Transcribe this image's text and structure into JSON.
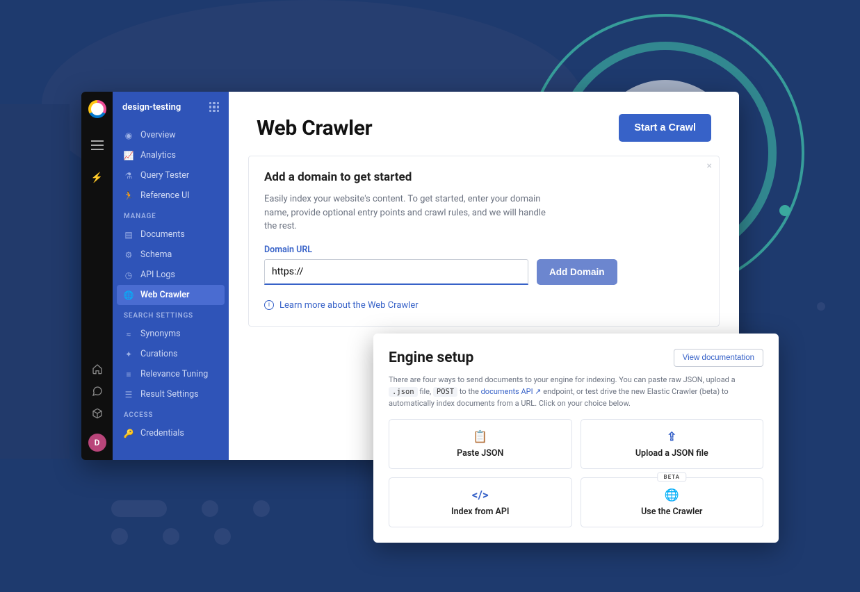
{
  "app_name": "design-testing",
  "rail": {
    "avatar_initial": "D"
  },
  "sidebar": {
    "groups": [
      {
        "label": "",
        "items": [
          {
            "icon": "binoculars-icon",
            "label": "Overview"
          },
          {
            "icon": "analytics-icon",
            "label": "Analytics"
          },
          {
            "icon": "flask-icon",
            "label": "Query Tester"
          },
          {
            "icon": "running-icon",
            "label": "Reference UI"
          }
        ]
      },
      {
        "label": "MANAGE",
        "items": [
          {
            "icon": "documents-icon",
            "label": "Documents"
          },
          {
            "icon": "gear-icon",
            "label": "Schema"
          },
          {
            "icon": "clock-icon",
            "label": "API Logs"
          },
          {
            "icon": "globe-icon",
            "label": "Web Crawler",
            "active": true
          }
        ]
      },
      {
        "label": "SEARCH SETTINGS",
        "items": [
          {
            "icon": "synonyms-icon",
            "label": "Synonyms"
          },
          {
            "icon": "curations-icon",
            "label": "Curations"
          },
          {
            "icon": "tuning-icon",
            "label": "Relevance Tuning"
          },
          {
            "icon": "results-icon",
            "label": "Result Settings"
          }
        ]
      },
      {
        "label": "ACCESS",
        "items": [
          {
            "icon": "key-icon",
            "label": "Credentials"
          }
        ]
      }
    ]
  },
  "page": {
    "title": "Web Crawler",
    "primary_action": "Start a Crawl",
    "card": {
      "title": "Add a domain to get started",
      "description": "Easily index your website's content. To get started, enter your domain name, provide optional entry points and crawl rules, and we will handle the rest.",
      "field_label": "Domain URL",
      "input_value": "https://",
      "submit_label": "Add Domain",
      "learn_more": "Learn more about the Web Crawler"
    }
  },
  "engine": {
    "title": "Engine setup",
    "doc_button": "View documentation",
    "description_parts": {
      "pre": "There are four ways to send documents to your engine for indexing. You can paste raw JSON, upload a ",
      "code1": ".json",
      "mid1": " file, ",
      "code2": "POST",
      "mid2": " to the ",
      "link": "documents API",
      "post": " endpoint, or test drive the new Elastic Crawler (beta) to automatically index documents from a URL. Click on your choice below."
    },
    "tiles": [
      {
        "icon": "paste-icon",
        "label": "Paste JSON"
      },
      {
        "icon": "upload-icon",
        "label": "Upload a JSON file"
      },
      {
        "icon": "code-icon",
        "label": "Index from API"
      },
      {
        "icon": "globe-icon",
        "label": "Use the Crawler",
        "badge": "BETA"
      }
    ]
  }
}
